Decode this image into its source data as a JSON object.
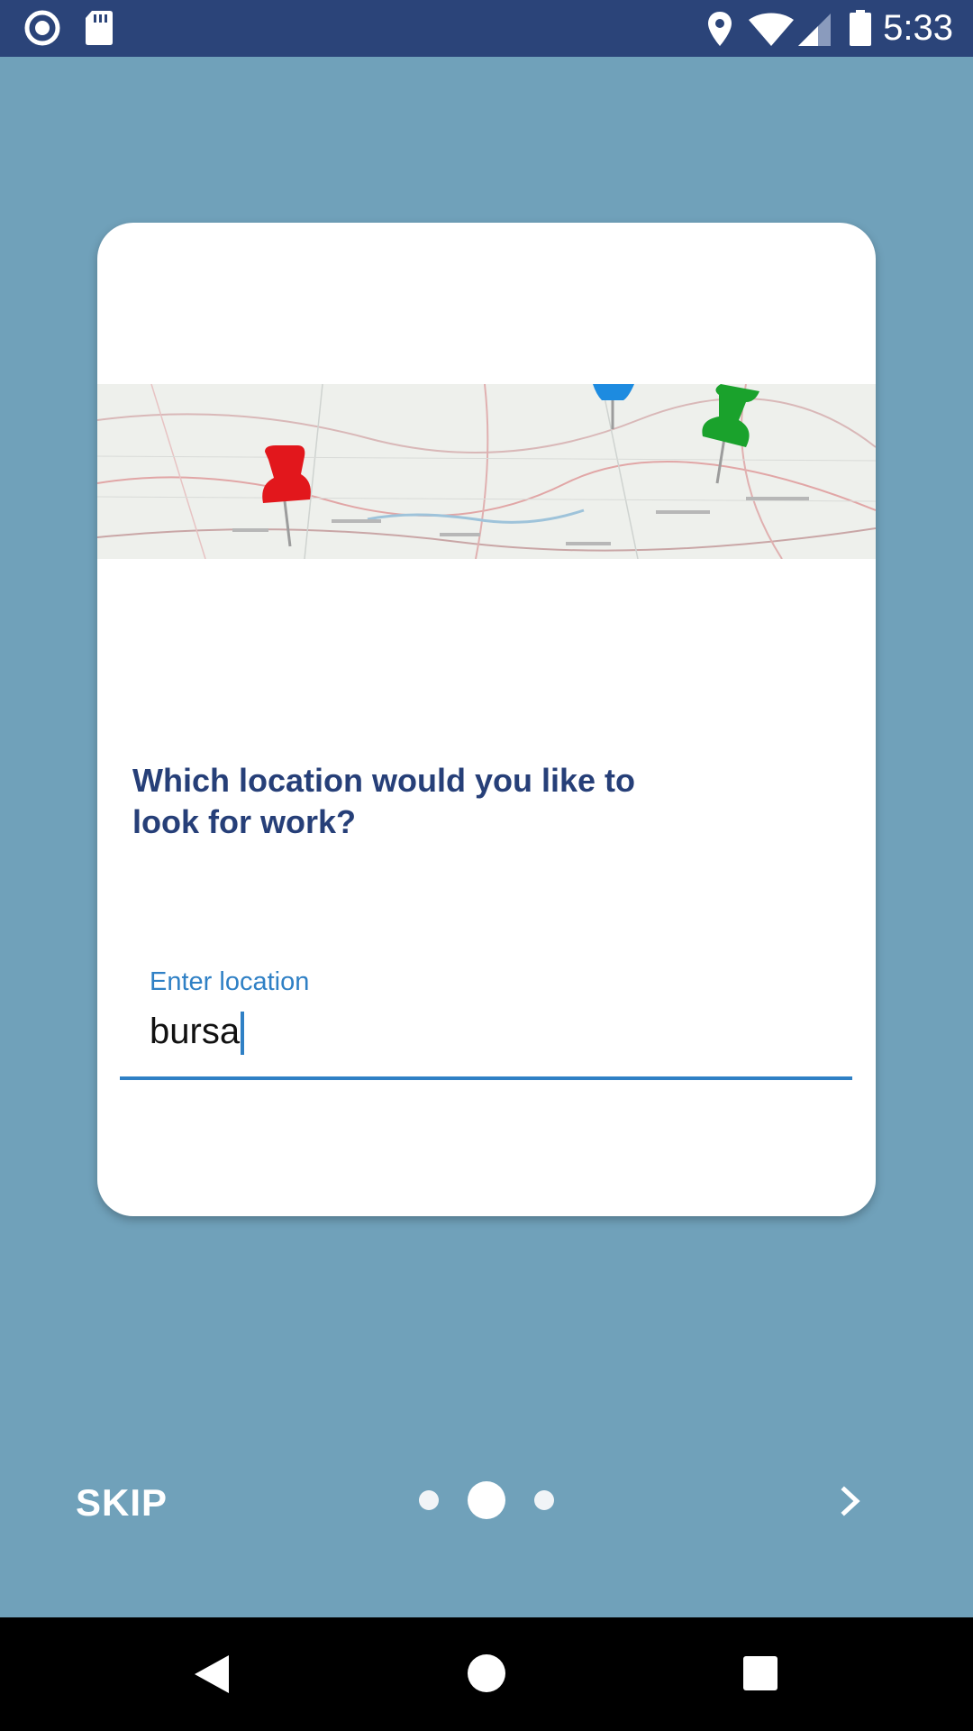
{
  "status_bar": {
    "time": "5:33",
    "icons": [
      "record-icon",
      "sd-card-icon",
      "location-icon",
      "wifi-icon",
      "signal-icon",
      "battery-icon"
    ]
  },
  "onboarding": {
    "question": "Which location would you like to look for work?",
    "location_field": {
      "label": "Enter location",
      "value": "bursa"
    },
    "skip_label": "SKIP",
    "page_indicator": {
      "current": 2,
      "total": 3
    }
  },
  "nav_bar": {
    "icons": [
      "back-icon",
      "home-icon",
      "recents-icon"
    ]
  },
  "colors": {
    "background": "#70a1ba",
    "status_bar": "#2b4479",
    "question_text": "#263f78",
    "accent": "#2f80c5"
  }
}
